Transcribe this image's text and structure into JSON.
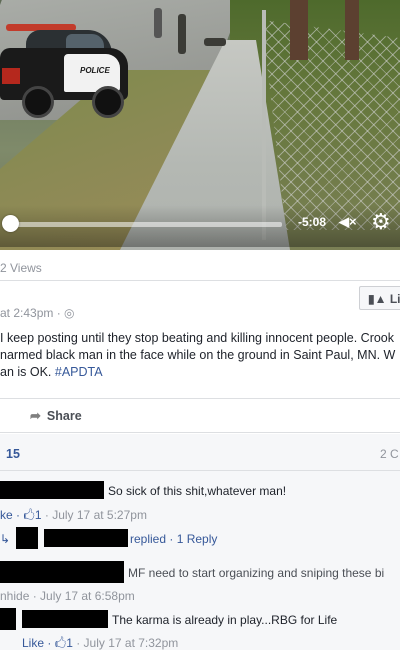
{
  "video": {
    "time_remaining": "-5:08",
    "mute_icon_text": "◀×",
    "settings_icon": "gear-icon",
    "car_label": "POLICE",
    "progress": 0.0
  },
  "post": {
    "views": "2 Views",
    "timestamp": "at 2:43pm ·",
    "like_label": "Lik",
    "text_line1": "I keep posting until they stop beating and killing innocent people. Crook",
    "text_line2": "narmed black man in the face while on the ground in Saint Paul, MN. W",
    "text_line3_prefix": "an is OK. ",
    "hashtag": "#APDTA",
    "share_label": "Share"
  },
  "reactions": {
    "likes": "15",
    "comments": "2 C"
  },
  "comments": [
    {
      "text": "So sick of this shit,whatever man!",
      "meta_prefix": "ke · ",
      "thumb": "👍",
      "meta_count": "1",
      "meta_rest": " · July 17 at 5:27pm"
    },
    {
      "replied_text": "replied · 1 Reply",
      "reply_arrow": "↳"
    },
    {
      "text": "MF need to start organizing and sniping these bi",
      "meta": "nhide · July 17 at 6:58pm"
    },
    {
      "text": "The karma is already in play...RBG for Life",
      "meta_prefix": "Like · ",
      "thumb": "👍",
      "meta_count": "1",
      "meta_rest": " · July 17 at 7:32pm"
    }
  ]
}
